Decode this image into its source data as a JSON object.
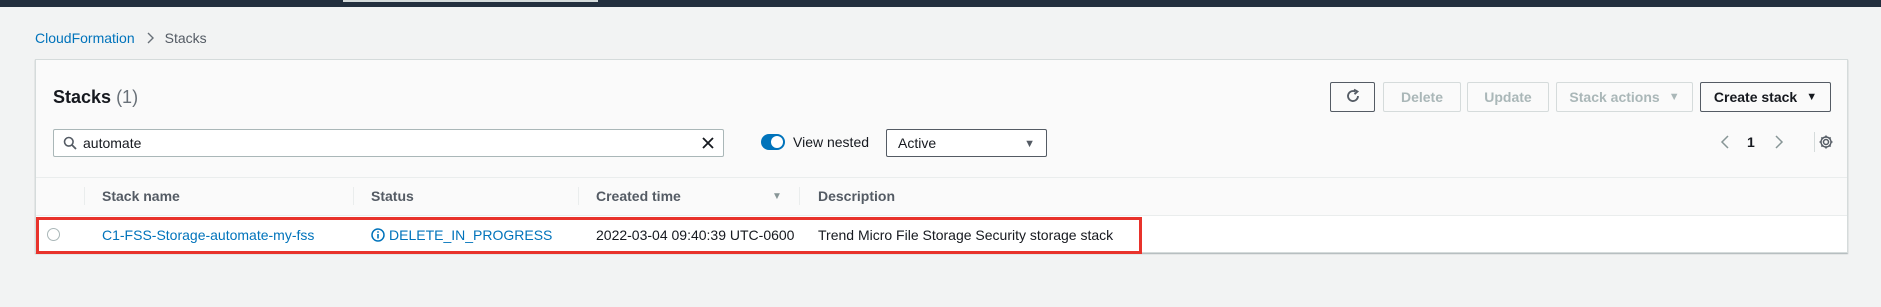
{
  "breadcrumb": {
    "root": "CloudFormation",
    "current": "Stacks"
  },
  "panel": {
    "title": "Stacks",
    "count": "(1)"
  },
  "toolbar": {
    "delete_label": "Delete",
    "update_label": "Update",
    "stack_actions_label": "Stack actions",
    "create_stack_label": "Create stack"
  },
  "filter": {
    "search_value": "automate",
    "view_nested_label": "View nested",
    "view_nested_on": true,
    "status_filter": "Active"
  },
  "pagination": {
    "current_page": "1"
  },
  "table": {
    "columns": [
      "Stack name",
      "Status",
      "Created time",
      "Description"
    ],
    "rows": [
      {
        "stack_name": "C1-FSS-Storage-automate-my-fss",
        "status": "DELETE_IN_PROGRESS",
        "created_time": "2022-03-04 09:40:39 UTC-0600",
        "description": "Trend Micro File Storage Security storage stack"
      }
    ]
  },
  "colors": {
    "link": "#0073bb",
    "highlight": "#e8322b",
    "header_bg": "#232f3e"
  },
  "icons": {
    "refresh": "refresh-icon",
    "search": "search-icon",
    "clear": "close-icon",
    "info": "info-icon",
    "settings": "gear-icon"
  }
}
